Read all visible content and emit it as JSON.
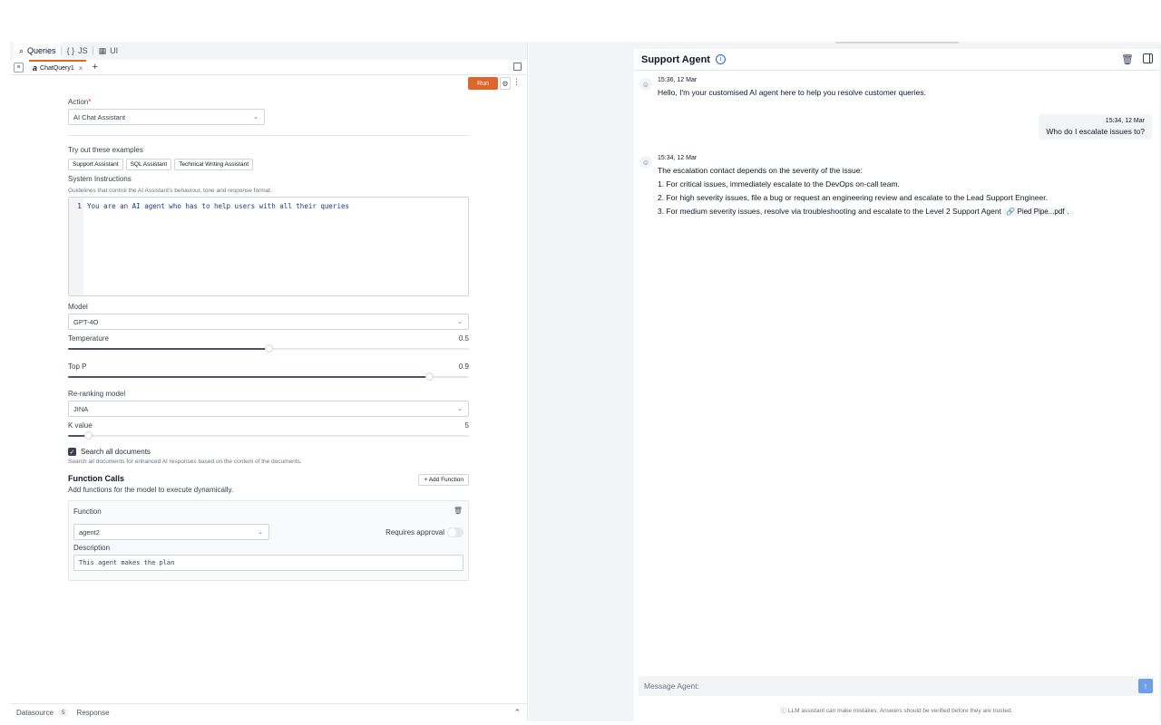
{
  "left_panel": {
    "top_tabs": [
      {
        "icon": "queries-icon",
        "label": "Queries",
        "active": true
      },
      {
        "icon": "code-braces-icon",
        "label": "JS",
        "active": false
      },
      {
        "icon": "grid-icon",
        "label": "UI",
        "active": false
      }
    ],
    "icons": {
      "queries": "⌕",
      "js": "{ }",
      "ui": "▦"
    },
    "query_tab": {
      "label": "ChatQuery1",
      "ai_glyph": "a",
      "close": "×",
      "plus": "+"
    },
    "toolbar": {
      "run_label": "Run",
      "gear": "⚙",
      "kebab": "⋮",
      "burger": "≡"
    },
    "action": {
      "label": "Action",
      "required_mark": "*",
      "value": "AI Chat Assistant"
    },
    "examples": {
      "label": "Try out these examples",
      "chips": [
        "Support Assistant",
        "SQL Assistant",
        "Technical Writing Assistant"
      ]
    },
    "system_instructions": {
      "label": "System Instructions",
      "help": "Guidelines that control the AI Assistant's behaviour, tone and response format.",
      "line_number": "1",
      "code": "You are an AI agent who has to help users with all their queries"
    },
    "model": {
      "label": "Model",
      "value": "GPT-4O"
    },
    "temperature": {
      "label": "Temperature",
      "value": "0.5",
      "fraction": 0.5
    },
    "top_p": {
      "label": "Top P",
      "value": "0.9",
      "fraction": 0.9
    },
    "reranking": {
      "label": "Re-ranking model",
      "value": "JINA"
    },
    "k_value": {
      "label": "K value",
      "value": "5",
      "fraction": 0.05
    },
    "search_docs": {
      "label": "Search all documents",
      "help": "Search all documents for enhanced AI responses based on the content of the documents.",
      "checked": true
    },
    "function_calls": {
      "title": "Function Calls",
      "help": "Add functions for the model to execute dynamically.",
      "add_label": "+ Add Function",
      "function": {
        "title": "Function",
        "select_value": "agent2",
        "requires_approval_label": "Requires approval",
        "description_label": "Description",
        "description_value": "This agent makes the plan"
      }
    },
    "bottom_tabs": {
      "datasource_label": "Datasource",
      "datasource_count": "5",
      "response_label": "Response",
      "chevron": "⌃"
    }
  },
  "chat": {
    "title": "Support Agent",
    "info_glyph": "i",
    "input_placeholder": "Message Agent:",
    "send_glyph": "↑",
    "disclaimer": "ⓘ LLM assistant can make mistakes. Answers should be verified before they are trusted.",
    "messages": [
      {
        "role": "bot",
        "time": "15:36, 12 Mar",
        "text": "Hello, I'm your customised AI agent here to help you resolve customer queries."
      },
      {
        "role": "user",
        "time": "15:34, 12 Mar",
        "text": "Who do I escalate issues to?"
      },
      {
        "role": "bot",
        "time": "15:34, 12 Mar",
        "intro": "The escalation contact depends on the severity of the issue:",
        "items": [
          "1. For critical issues, immediately escalate to the DevOps on-call team.",
          "2. For high severity issues, file a bug or request an engineering review and escalate to the Lead Support Engineer.",
          "3. For medium severity issues, resolve via troubleshooting and escalate to the Level 2 Support Agent"
        ],
        "attachment": "🔗 Pied Pipe...pdf",
        "trailing": "."
      }
    ]
  },
  "colors": {
    "accent": "#e0652d",
    "send": "#6ea0e8",
    "info": "#2563eb"
  }
}
